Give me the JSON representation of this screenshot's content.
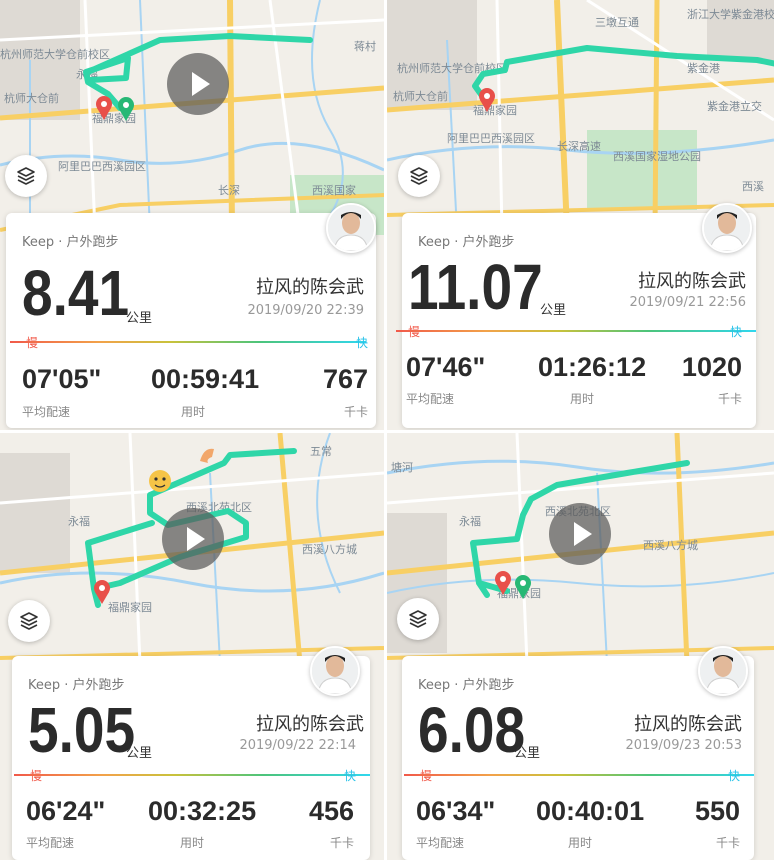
{
  "colors": {
    "map_bg": "#f2efe9",
    "road": "#f8cf64",
    "water": "#a8d4f3",
    "route": "#2fd6a8",
    "slow": "#f15a4a",
    "fast": "#27c2e8"
  },
  "icons": {
    "play": "play-icon",
    "layers": "layers-icon",
    "avatar": "avatar-image",
    "pin_start": "green-pin-icon",
    "pin_end": "red-pin-icon"
  },
  "panels": [
    {
      "map_labels": [
        "杭州师范大学仓前校区",
        "永福",
        "杭师大仓前",
        "福鼎家园",
        "阿里巴巴西溪园区",
        "长深",
        "西溪国家",
        "蒋村"
      ],
      "card": {
        "source": "Keep · 户外跑步",
        "distance": "8.41",
        "unit": "公里",
        "name": "拉风的陈会武",
        "date": "2019/09/20 22:39",
        "slow": "慢",
        "fast": "快",
        "stats": [
          {
            "value": "07'05\"",
            "label": "平均配速"
          },
          {
            "value": "00:59:41",
            "label": "用时"
          },
          {
            "value": "767",
            "label": "千卡"
          }
        ]
      }
    },
    {
      "map_labels": [
        "三墩互通",
        "浙江大学紫金港校区",
        "杭州师范大学仓前校区",
        "杭师大仓前",
        "福鼎家园",
        "紫金港",
        "紫金港立交",
        "阿里巴巴西溪园区",
        "长深高速",
        "西溪国家湿地公园",
        "西溪"
      ],
      "card": {
        "source": "Keep · 户外跑步",
        "distance": "11.07",
        "unit": "公里",
        "name": "拉风的陈会武",
        "date": "2019/09/21 22:56",
        "slow": "慢",
        "fast": "快",
        "stats": [
          {
            "value": "07'46\"",
            "label": "平均配速"
          },
          {
            "value": "01:26:12",
            "label": "用时"
          },
          {
            "value": "1020",
            "label": "千卡"
          }
        ]
      }
    },
    {
      "map_labels": [
        "五常",
        "永福",
        "西溪北苑北区",
        "西溪八方城",
        "福鼎家园"
      ],
      "card": {
        "source": "Keep · 户外跑步",
        "distance": "5.05",
        "unit": "公里",
        "name": "拉风的陈会武",
        "date": "2019/09/22 22:14",
        "slow": "慢",
        "fast": "快",
        "stats": [
          {
            "value": "06'24\"",
            "label": "平均配速"
          },
          {
            "value": "00:32:25",
            "label": "用时"
          },
          {
            "value": "456",
            "label": "千卡"
          }
        ]
      }
    },
    {
      "map_labels": [
        "塘河",
        "永福",
        "西溪北苑北区",
        "西溪八方城",
        "福鼎家园"
      ],
      "card": {
        "source": "Keep · 户外跑步",
        "distance": "6.08",
        "unit": "公里",
        "name": "拉风的陈会武",
        "date": "2019/09/23 20:53",
        "slow": "慢",
        "fast": "快",
        "stats": [
          {
            "value": "06'34\"",
            "label": "平均配速"
          },
          {
            "value": "00:40:01",
            "label": "用时"
          },
          {
            "value": "550",
            "label": "千卡"
          }
        ]
      }
    }
  ]
}
